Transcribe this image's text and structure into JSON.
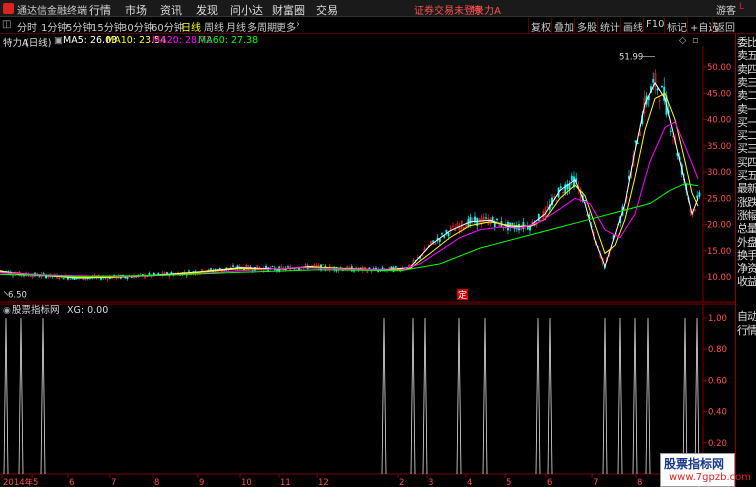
{
  "titlebar": {
    "app_name": "通达信金融终端",
    "menus": [
      "行情",
      "市场",
      "资讯",
      "发现",
      "问小达",
      "财富圈",
      "交易"
    ],
    "notice": "证券交易未登录",
    "stock_name": "特 力A",
    "right_menus": [
      "游客"
    ]
  },
  "toolbar": {
    "periods": [
      "分时",
      "1分钟",
      "5分钟",
      "15分钟",
      "30分钟",
      "60分钟",
      "日线",
      "周线",
      "月线",
      "多周期",
      "更多"
    ],
    "active_period": "日线",
    "right_tools": [
      "复权",
      "叠加",
      "多股",
      "统计",
      "画线",
      "F10",
      "标记",
      "+自选",
      "返回"
    ]
  },
  "header": {
    "stock": "特力A",
    "period": "(日线)",
    "ma5": "MA5: 26.03",
    "ma10": "MA10: 23.54",
    "ma20": "MA20: 28.72",
    "ma60": "MA60: 27.38"
  },
  "right_panel": {
    "items": [
      "委比",
      "卖五",
      "卖四",
      "卖三",
      "卖二",
      "卖一",
      "买一",
      "买二",
      "买三",
      "买四",
      "买五",
      "最新",
      "涨跌",
      "涨幅",
      "总量",
      "外盘",
      "换手",
      "净资",
      "收益"
    ],
    "bottom_items": [
      "自动",
      "行情"
    ]
  },
  "price_axis": {
    "ticks": [
      "50.00",
      "45.00",
      "40.00",
      "35.00",
      "30.00",
      "25.00",
      "20.00",
      "15.00",
      "10.00"
    ]
  },
  "price_annotations": {
    "high_label": "51.99",
    "low_label": "6.50",
    "marker": "定"
  },
  "indicator": {
    "name": "股票指标网",
    "value": "XG: 0.00",
    "axis_ticks": [
      "1.00",
      "0.80",
      "0.60",
      "0.40",
      "0.20"
    ]
  },
  "date_axis": {
    "labels": [
      "2014年",
      "5",
      "6",
      "7",
      "8",
      "9",
      "10",
      "11",
      "12",
      "2",
      "3",
      "4",
      "5",
      "6",
      "7",
      "8"
    ]
  },
  "watermark": {
    "line1": "股票指标网",
    "line2": "www.7gpzb.com"
  },
  "colors": {
    "up": "#ff3030",
    "down": "#00ffff",
    "ma5": "#ffffff",
    "ma10": "#ffff00",
    "ma20": "#ff00ff",
    "ma60": "#00ff00",
    "grid": "#800000"
  },
  "chart_data": [
    {
      "type": "line",
      "title": "",
      "series": [
        {
          "name": "MA5",
          "points": [
            [
              0,
              11.2
            ],
            [
              20,
              10.5
            ],
            [
              50,
              10.2
            ],
            [
              80,
              9.8
            ],
            [
              120,
              10.0
            ],
            [
              160,
              10.4
            ],
            [
              200,
              11.0
            ],
            [
              240,
              11.8
            ],
            [
              280,
              11.5
            ],
            [
              310,
              12.0
            ],
            [
              340,
              11.6
            ],
            [
              380,
              11.3
            ],
            [
              410,
              11.8
            ],
            [
              430,
              16
            ],
            [
              450,
              18.8
            ],
            [
              470,
              20.5
            ],
            [
              490,
              20.8
            ],
            [
              510,
              19.5
            ],
            [
              530,
              19.8
            ],
            [
              545,
              22
            ],
            [
              560,
              26.5
            ],
            [
              575,
              28.5
            ],
            [
              585,
              24
            ],
            [
              595,
              17
            ],
            [
              605,
              12
            ],
            [
              615,
              18
            ],
            [
              625,
              24
            ],
            [
              635,
              34
            ],
            [
              645,
              43
            ],
            [
              655,
              47
            ],
            [
              665,
              44
            ],
            [
              675,
              36
            ],
            [
              685,
              28
            ],
            [
              692,
              22
            ],
            [
              698,
              25
            ]
          ]
        },
        {
          "name": "MA10",
          "points": [
            [
              0,
              11.0
            ],
            [
              40,
              10.4
            ],
            [
              80,
              9.9
            ],
            [
              120,
              10.0
            ],
            [
              160,
              10.3
            ],
            [
              200,
              10.9
            ],
            [
              240,
              11.6
            ],
            [
              280,
              11.5
            ],
            [
              310,
              11.9
            ],
            [
              340,
              11.7
            ],
            [
              380,
              11.4
            ],
            [
              410,
              11.6
            ],
            [
              430,
              14.5
            ],
            [
              450,
              17.5
            ],
            [
              470,
              19.8
            ],
            [
              490,
              20.5
            ],
            [
              510,
              19.8
            ],
            [
              530,
              19.6
            ],
            [
              545,
              21
            ],
            [
              560,
              25
            ],
            [
              575,
              27.5
            ],
            [
              585,
              25.5
            ],
            [
              595,
              20
            ],
            [
              605,
              14.5
            ],
            [
              615,
              16
            ],
            [
              625,
              21
            ],
            [
              635,
              29
            ],
            [
              645,
              38
            ],
            [
              655,
              44
            ],
            [
              665,
              45
            ],
            [
              675,
              40
            ],
            [
              685,
              32
            ],
            [
              692,
              26
            ],
            [
              698,
              23.5
            ]
          ]
        },
        {
          "name": "MA20",
          "points": [
            [
              0,
              10.8
            ],
            [
              60,
              10.3
            ],
            [
              120,
              10.1
            ],
            [
              180,
              10.4
            ],
            [
              240,
              11.2
            ],
            [
              300,
              11.8
            ],
            [
              350,
              11.5
            ],
            [
              400,
              11.3
            ],
            [
              420,
              12.5
            ],
            [
              440,
              15
            ],
            [
              460,
              17.5
            ],
            [
              480,
              19
            ],
            [
              500,
              19.5
            ],
            [
              520,
              19.3
            ],
            [
              540,
              20.5
            ],
            [
              560,
              23
            ],
            [
              575,
              25
            ],
            [
              590,
              24
            ],
            [
              605,
              19
            ],
            [
              620,
              17.5
            ],
            [
              635,
              22
            ],
            [
              650,
              32
            ],
            [
              665,
              38.5
            ],
            [
              675,
              39.5
            ],
            [
              685,
              35
            ],
            [
              698,
              28.7
            ]
          ]
        },
        {
          "name": "MA60",
          "points": [
            [
              0,
              10.5
            ],
            [
              80,
              10.1
            ],
            [
              160,
              10.3
            ],
            [
              240,
              10.9
            ],
            [
              320,
              11.4
            ],
            [
              400,
              11.2
            ],
            [
              440,
              12.5
            ],
            [
              480,
              15.5
            ],
            [
              520,
              17.5
            ],
            [
              560,
              19.5
            ],
            [
              590,
              21
            ],
            [
              620,
              22.5
            ],
            [
              650,
              24
            ],
            [
              670,
              26.5
            ],
            [
              685,
              27.8
            ],
            [
              698,
              27.4
            ]
          ]
        }
      ],
      "ylim": [
        6,
        54
      ]
    },
    {
      "type": "bar",
      "title": "",
      "series": [
        {
          "name": "XG",
          "x": [
            6,
            21,
            43,
            384,
            413,
            425,
            459,
            485,
            538,
            550,
            605,
            620,
            635,
            648,
            685,
            697
          ],
          "values": [
            1,
            1,
            1,
            1,
            1,
            1,
            1,
            1,
            1,
            1,
            1,
            1,
            1,
            1,
            1,
            1
          ]
        }
      ],
      "ylim": [
        0,
        1
      ]
    }
  ]
}
